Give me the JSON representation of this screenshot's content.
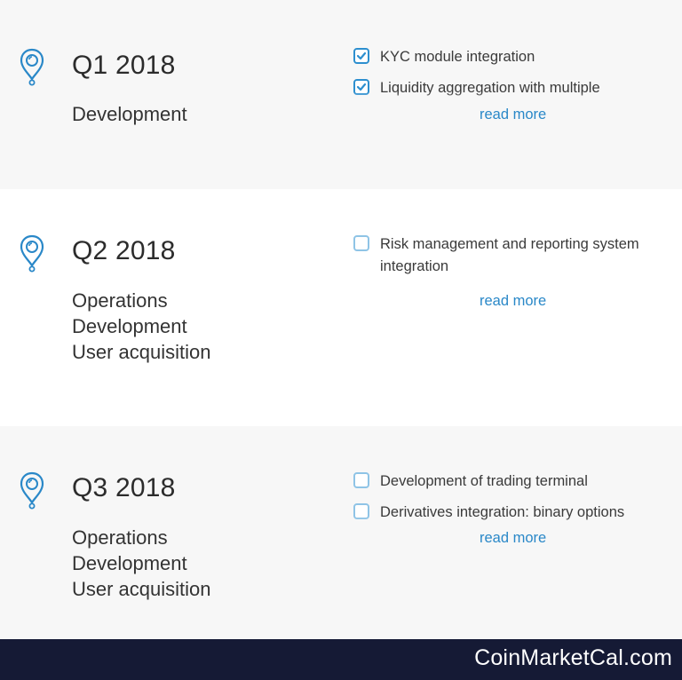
{
  "milestones": [
    {
      "quarter": "Q1 2018",
      "categories": [
        "Development"
      ],
      "tasks": [
        {
          "label": "KYC module integration",
          "checked": true
        },
        {
          "label": "Liquidity aggregation with multiple",
          "checked": true
        }
      ],
      "read_more": "read more"
    },
    {
      "quarter": "Q2 2018",
      "categories": [
        "Operations",
        "Development",
        "User acquisition"
      ],
      "tasks": [
        {
          "label": "Risk management and reporting system integration",
          "checked": false
        }
      ],
      "read_more": "read more"
    },
    {
      "quarter": "Q3 2018",
      "categories": [
        "Operations",
        "Development",
        "User acquisition"
      ],
      "tasks": [
        {
          "label": "Development of trading terminal",
          "checked": false
        },
        {
          "label": "Derivatives integration: binary options",
          "checked": false
        }
      ],
      "read_more": "read more"
    }
  ],
  "footer": {
    "brand": "CoinMarketCal.com"
  },
  "colors": {
    "accent": "#2a88c8",
    "footer_bg": "#151a35",
    "section_bg": "#f7f7f7"
  },
  "icons": {
    "pin": "map-pin-icon",
    "check": "checkbox-checked-icon"
  }
}
